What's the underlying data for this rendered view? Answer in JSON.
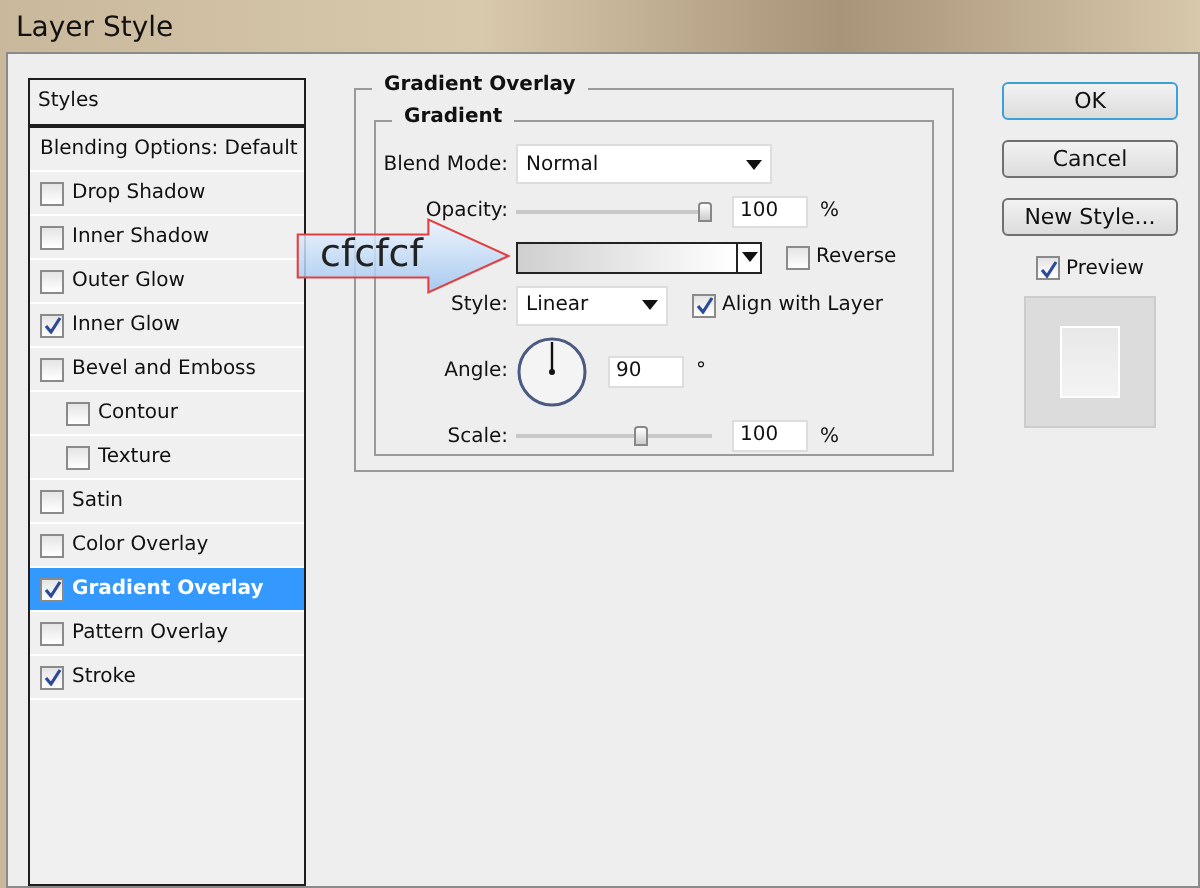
{
  "window": {
    "title": "Layer Style"
  },
  "styles_panel": {
    "header": "Styles",
    "items": [
      {
        "label": "Blending Options: Default",
        "kind": "plain",
        "selected": false
      },
      {
        "label": "Drop Shadow",
        "kind": "checkbox",
        "checked": false,
        "selected": false
      },
      {
        "label": "Inner Shadow",
        "kind": "checkbox",
        "checked": false,
        "selected": false
      },
      {
        "label": "Outer Glow",
        "kind": "checkbox",
        "checked": false,
        "selected": false
      },
      {
        "label": "Inner Glow",
        "kind": "checkbox",
        "checked": true,
        "selected": false
      },
      {
        "label": "Bevel and Emboss",
        "kind": "checkbox",
        "checked": false,
        "selected": false,
        "children": [
          {
            "label": "Contour",
            "kind": "checkbox",
            "checked": false,
            "selected": false
          },
          {
            "label": "Texture",
            "kind": "checkbox",
            "checked": false,
            "selected": false
          }
        ]
      },
      {
        "label": "Satin",
        "kind": "checkbox",
        "checked": false,
        "selected": false
      },
      {
        "label": "Color Overlay",
        "kind": "checkbox",
        "checked": false,
        "selected": false
      },
      {
        "label": "Gradient Overlay",
        "kind": "checkbox",
        "checked": true,
        "selected": true
      },
      {
        "label": "Pattern Overlay",
        "kind": "checkbox",
        "checked": false,
        "selected": false
      },
      {
        "label": "Stroke",
        "kind": "checkbox",
        "checked": true,
        "selected": false
      }
    ]
  },
  "gradient_overlay": {
    "title": "Gradient Overlay",
    "group_title": "Gradient",
    "blend_mode": {
      "label": "Blend Mode:",
      "value": "Normal"
    },
    "opacity": {
      "label": "Opacity:",
      "level": 0.97,
      "value": "100",
      "unit": "%"
    },
    "gradient": {
      "reverse": {
        "label": "Reverse",
        "checked": false
      }
    },
    "style": {
      "label": "Style:",
      "value": "Linear"
    },
    "align_with_layer": {
      "label": "Align with Layer",
      "checked": true
    },
    "angle": {
      "label": "Angle:",
      "value": "90",
      "unit": "°"
    },
    "scale": {
      "label": "Scale:",
      "level": 0.64,
      "value": "100",
      "unit": "%"
    }
  },
  "callout": {
    "text": "cfcfcf"
  },
  "buttons": [
    {
      "label": "OK",
      "default": true
    },
    {
      "label": "Cancel",
      "default": false
    },
    {
      "label": "New Style...",
      "default": false
    }
  ],
  "preview": {
    "label": "Preview",
    "checked": true
  }
}
